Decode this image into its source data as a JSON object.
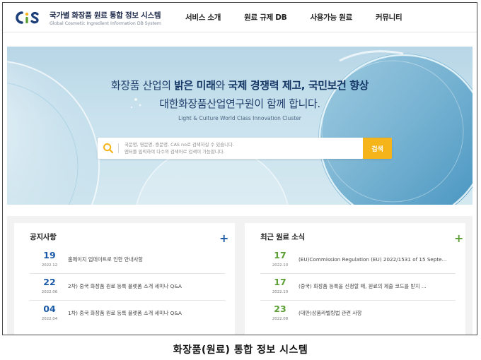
{
  "header": {
    "logo_title": "국가별 화장품 원료 통합 정보 시스템",
    "logo_subtitle": "Global Cosmetic Ingredient Information DB System",
    "nav": [
      "서비스 소개",
      "원료 규제 DB",
      "사용가능 원료",
      "커뮤니티"
    ]
  },
  "hero": {
    "line1_pre": "화장품 산업의 ",
    "line1_b1": "밝은 미래",
    "line1_mid": "와 ",
    "line1_b2": "국제 경쟁력 제고, 국민보건 향상",
    "line2": "대한화장품산업연구원이 함께 합니다.",
    "tagline": "Light & Culture World Class Innovation Cluster"
  },
  "search": {
    "hint1": "국문명, 영문명, 중문명, CAS no로 검색하실 수 있습니다.",
    "hint2": "엔터를 입력하여 다수의 검색어로 검색이 가능합니다.",
    "button": "검색",
    "icon": "search-icon"
  },
  "notices": {
    "title": "공지사항",
    "more": "+",
    "items": [
      {
        "day": "19",
        "ym": "2022.12",
        "text": "홈페이지 업데이트로 인한 안내사항"
      },
      {
        "day": "22",
        "ym": "2022.06",
        "text": "2차) 중국 화장품 원료 등록 플랫폼 소개 세미나 Q&A"
      },
      {
        "day": "04",
        "ym": "2022.04",
        "text": "1차) 중국 화장품 원료 등록 플랫폼 소개 세미나 Q&A"
      }
    ]
  },
  "news": {
    "title": "최근 원료 소식",
    "more": "+",
    "items": [
      {
        "day": "17",
        "ym": "2022.10",
        "text": "(EU)Commission Regulation (EU) 2022/1531 of 15 Septe..."
      },
      {
        "day": "17",
        "ym": "2022.10",
        "text": "(중국) 화장품 등록을 신청할 때, 원료의 제출 코드를 받지 ..."
      },
      {
        "day": "23",
        "ym": "2022.08",
        "text": "(대만)상품라벨링법 관련 사항"
      }
    ]
  },
  "caption": "화장품(원료) 통합 정보 시스템",
  "colors": {
    "accent_blue": "#1b5aa6",
    "accent_green": "#5ca035",
    "search_button": "#f5b41a"
  }
}
